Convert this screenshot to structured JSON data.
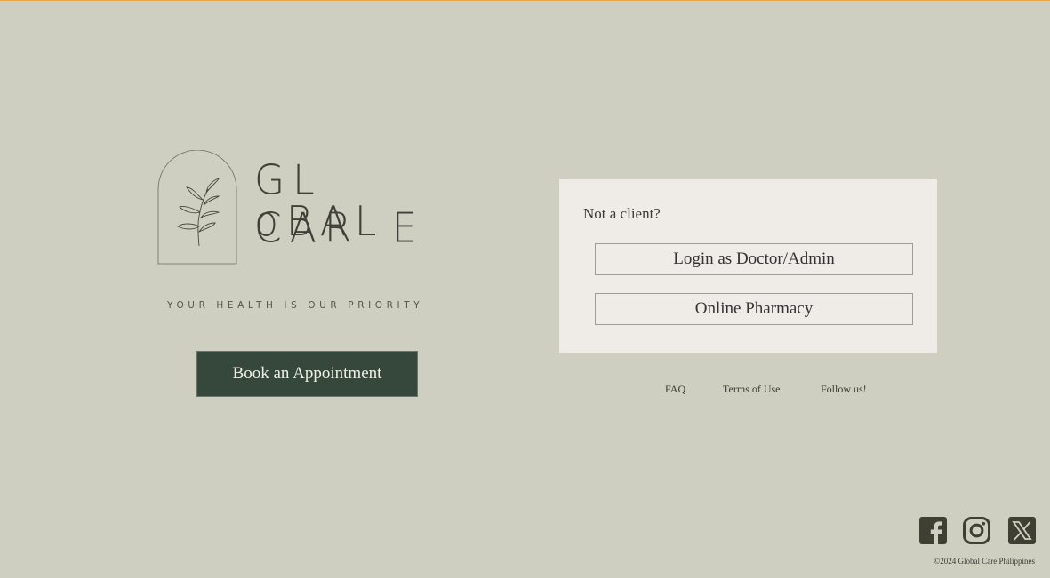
{
  "brand": {
    "line1": "GL oBAL",
    "line2": "CAR  E",
    "tagline": "YOUR HEALTH IS OUR PRIORITY"
  },
  "actions": {
    "book_label": "Book an Appointment"
  },
  "card": {
    "prompt": "Not a client?",
    "login_label": "Login as Doctor/Admin",
    "pharmacy_label": "Online Pharmacy"
  },
  "footer": {
    "links": [
      "FAQ",
      "Terms of Use",
      "Follow us!"
    ],
    "social": [
      "facebook-icon",
      "instagram-icon",
      "x-icon"
    ],
    "copyright": "©2024 Global Care Philippines"
  },
  "colors": {
    "background": "#cecfc1",
    "button_dark": "#36483b",
    "card": "#efebe6",
    "icon": "#3f3f33"
  }
}
